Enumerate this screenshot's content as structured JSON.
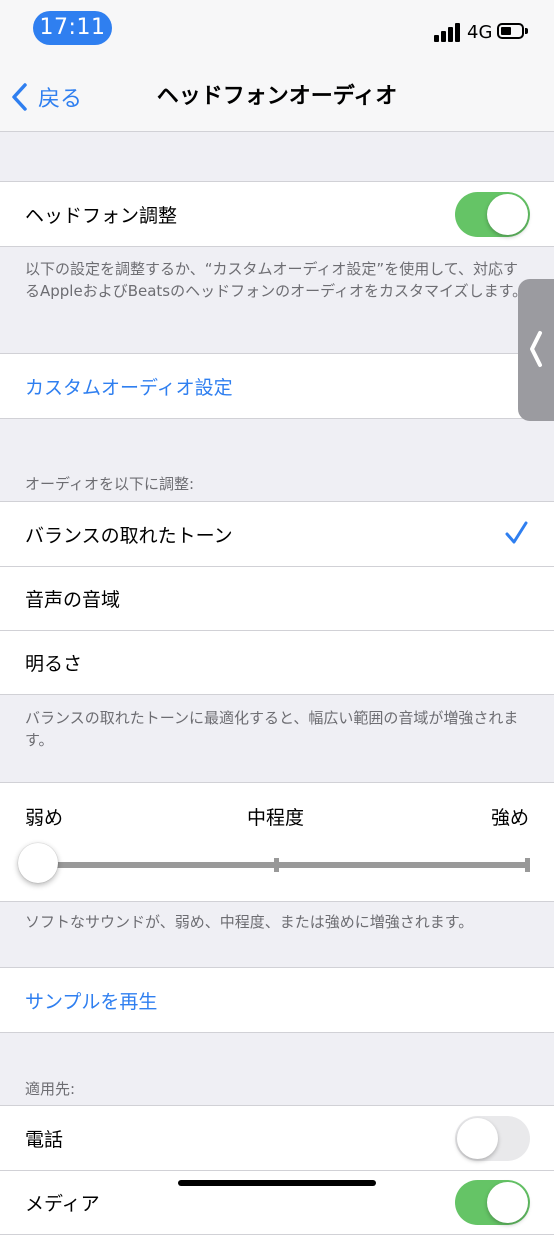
{
  "status_bar": {
    "time": "17:11",
    "network": "4G"
  },
  "nav": {
    "back_label": "戻る",
    "title": "ヘッドフォンオーディオ"
  },
  "headphone_adjust": {
    "label": "ヘッドフォン調整",
    "enabled": true,
    "footer": "以下の設定を調整するか、“カスタムオーディオ設定”を使用して、対応するAppleおよびBeatsのヘッドフォンのオーディオをカスタマイズします。"
  },
  "custom_audio": {
    "label": "カスタムオーディオ設定"
  },
  "tune": {
    "header": "オーディオを以下に調整:",
    "options": [
      "バランスの取れたトーン",
      "音声の音域",
      "明るさ"
    ],
    "selected": "バランスの取れたトーン",
    "footer": "バランスの取れたトーンに最適化すると、幅広い範囲の音域が増強されます。"
  },
  "strength": {
    "labels": [
      "弱め",
      "中程度",
      "強め"
    ],
    "value": "弱め",
    "footer": "ソフトなサウンドが、弱め、中程度、または強めに増強されます。"
  },
  "play_sample": {
    "label": "サンプルを再生"
  },
  "apply_to": {
    "header": "適用先:",
    "items": [
      {
        "label": "電話",
        "enabled": false
      },
      {
        "label": "メディア",
        "enabled": true
      }
    ]
  },
  "colors": {
    "accent": "#2f7ff0",
    "toggle_on": "#65c466",
    "background": "#efeff4"
  }
}
